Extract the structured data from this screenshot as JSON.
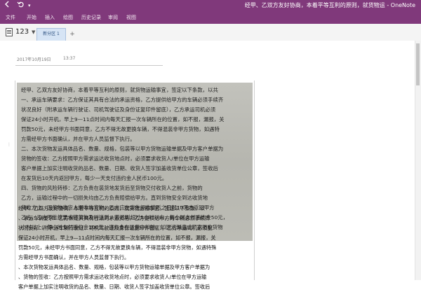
{
  "title_bar": {
    "document_title": "经甲、乙双方友好协商，本着平等互利的原则，就货物运 - OneNote",
    "app_icon": "onenote-icon",
    "back_icon": "back-arrow-icon",
    "undo_icon": "undo-icon"
  },
  "ribbon": {
    "tabs": [
      {
        "label": "文件"
      },
      {
        "label": "开始"
      },
      {
        "label": "插入"
      },
      {
        "label": "绘图"
      },
      {
        "label": "历史记录"
      },
      {
        "label": "审阅"
      },
      {
        "label": "视图"
      }
    ]
  },
  "notebook": {
    "name": "123",
    "section_tab": "新分区 1",
    "add_tab": "+"
  },
  "page": {
    "date": "2017年10月19日",
    "time": "13:37"
  },
  "scan_lines": [
    "经甲、乙双方友好协商，本着平等互利的原则，就货物运输事宜，签定以下条款，以共",
    "一、承运车辆要求：乙方保证其具有合法的承运资格，乙方提供给甲方的车辆必须手续齐",
    "状况良好（附承运车辆行驶证、司机驾驶证及身份证复印件留底），乙方承运司机必须",
    "保证24小时开机，早上9—11点时间内每天汇报一次车辆所在的位置，如不报，漏报，关",
    "罚款50元，未经甲方书面同意，乙方不得无故更换车辆，不得混装非甲方货物，如遇特",
    "方需经甲方书面确认，并在甲方人员监督下执行。",
    "二、本次货物发运具体品名、数量、规格，包装等以甲方货物运输单据及甲方客户单据为",
    "货物的签收：乙方按照甲方需求运达收货地点时，必须要求收货人/单位在甲方运输",
    "客户单据上加实注明收货的品名、数量、日期、收货人签字加盖收货单位公章，签收后",
    "在发货后10天内返回甲方，每少一天支付违约金人民币100元。",
    "四、货物的风险转移：乙方负责在装货地发货后至货物交付收货人之前，货物的",
    "乙方，运输过程中的一切损失均由乙方负责赔偿给甲方。直到货物安全到达收货地",
    "货收方止，因货物收货人拒收的货物，乙方应在发生拒收情形之日起10天内返回甲方",
    "乙方，乙方不能按要求将货物及时送到，若迟到超过5小时以内，每小时支付违约金50元，",
    "小时以上，每小时支付违约金100元，违约金在运费中扣除，如因迟到造成厂家拒收货物"
  ],
  "ocr_lines": [
    "经甲、乙双方友好协商，本着平等互利的原则，就货物运输事宜，签定以下条款，以",
    "、承运车辆要求：乙方保证其具有合法的承运资格，乙方提供给甲方的车辆必须手续齐",
    "状况良好（附承运车辆行驶证、司机驾驶证及身份证复印件留底）。乙方承运司机必须配",
    "保证24小时开机，早上9—11点时间内每天汇报一次车辆所在的位置，如不报，漏报，关",
    "罚款50元，未经甲方书面同意，乙方不得无故更换车辆，不得混装非甲方货物，如遇特殊",
    "方需经甲方书面确认，并在甲方人员监督下执行。",
    "、本次货物发运具体品名、数量、规格，包装等以甲方货物运输单据及甲方客户单据为",
    "、货物的签收：乙方按照甲方需求运达收货地点时，必须要求收货人/单位在甲方运输",
    "客户单据上加实注明收货的品名、数量、日期、收货人签字加盖收货单位公章。签收后"
  ],
  "colors": {
    "accent": "#80397b",
    "section_tab_bg": "#d6e4f5"
  }
}
